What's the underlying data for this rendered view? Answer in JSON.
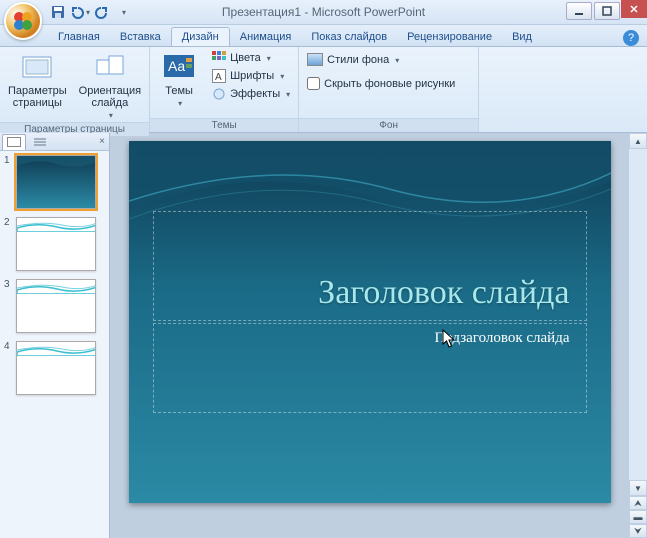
{
  "title": "Презентация1 - Microsoft PowerPoint",
  "qat": {
    "save": "save",
    "undo": "undo",
    "redo": "redo",
    "more": "more"
  },
  "tabs": [
    "Главная",
    "Вставка",
    "Дизайн",
    "Анимация",
    "Показ слайдов",
    "Рецензирование",
    "Вид"
  ],
  "activeTab": 2,
  "ribbon": {
    "pageSetup": {
      "label": "Параметры страницы",
      "pageParams": "Параметры\nстраницы",
      "orientation": "Ориентация\nслайда"
    },
    "themes": {
      "label": "Темы",
      "themesBtn": "Темы",
      "colors": "Цвета",
      "fonts": "Шрифты",
      "effects": "Эффекты"
    },
    "background": {
      "label": "Фон",
      "bgStyles": "Стили фона",
      "hideBg": "Скрыть фоновые рисунки"
    }
  },
  "thumbnails": [
    1,
    2,
    3,
    4
  ],
  "selectedSlide": 1,
  "slide": {
    "title": "Заголовок слайда",
    "subtitle": "Подзаголовок слайда"
  }
}
